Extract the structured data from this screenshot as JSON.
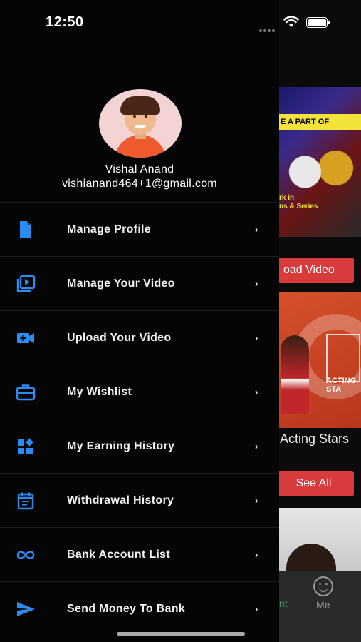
{
  "status": {
    "time": "12:50"
  },
  "profile": {
    "name": "Vishal Anand",
    "email": "vishianand464+1@gmail.com"
  },
  "menu": [
    {
      "label": "Manage Profile",
      "icon": "document-icon"
    },
    {
      "label": "Manage Your Video",
      "icon": "video-library-icon"
    },
    {
      "label": "Upload Your Video",
      "icon": "video-add-icon"
    },
    {
      "label": "My Wishlist",
      "icon": "briefcase-icon"
    },
    {
      "label": "My Earning History",
      "icon": "widgets-icon"
    },
    {
      "label": "Withdrawal History",
      "icon": "calendar-list-icon"
    },
    {
      "label": "Bank Account List",
      "icon": "infinity-icon"
    },
    {
      "label": "Send Money To Bank",
      "icon": "send-icon"
    }
  ],
  "background": {
    "banner_text": "E A PART OF",
    "banner_caption_line1": "rk in",
    "banner_caption_line2": "ns & Series",
    "upload_button": "oad Video",
    "acting_badge": "ACTING STA",
    "section_title": "Acting Stars",
    "see_all_button": "See All",
    "tab_partial": "nt",
    "tab_me": "Me"
  },
  "colors": {
    "accent": "#2d8cf0",
    "button_red": "#d83b3b",
    "drawer_bg": "#050505"
  }
}
